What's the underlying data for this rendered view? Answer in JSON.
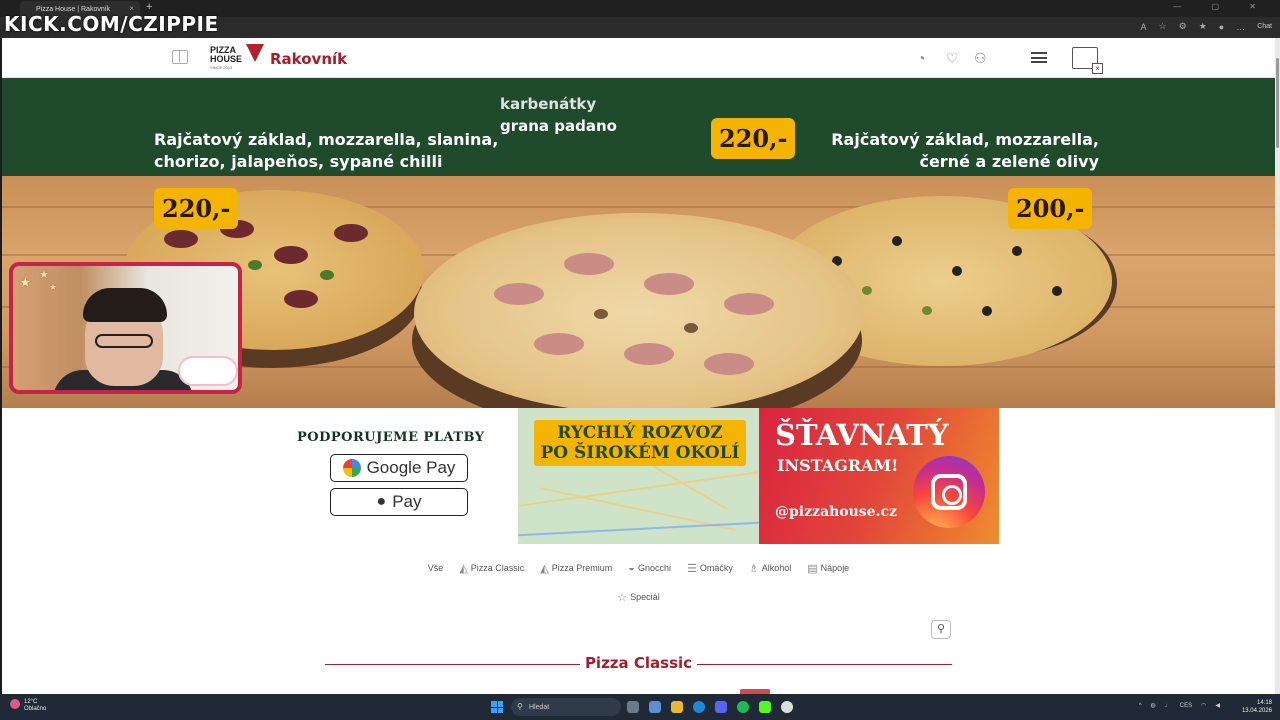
{
  "browser": {
    "tab_title": "Pizza House | Rakovník",
    "tab_close": "×",
    "new_tab": "+",
    "chat_label": "Chat",
    "window_controls": "— ▢ ✕"
  },
  "stream_overlay": {
    "channel": "KICK.COM/CZIPPIE"
  },
  "site": {
    "logo_line1": "PIZZA",
    "logo_line2": "HOUSE",
    "logo_since": "SINCE 2013",
    "city": "Rakovník"
  },
  "hero": {
    "left_desc_line1": "Rajčatový základ, mozzarella, slanina,",
    "left_desc_line2": "chorizo, jalapeňos, sypané chilli",
    "left_price": "220,-",
    "middle_desc_line1": "karbenátky",
    "middle_desc_line2": "grana padano",
    "middle_price": "220,-",
    "right_desc_line1": "Rajčatový základ, mozzarella,",
    "right_desc_line2": "černé a zelené olivy",
    "right_price": "200,-"
  },
  "payments": {
    "title": "PODPORUJEME PLATBY",
    "google_pay": "Google Pay",
    "apple_pay": "Pay"
  },
  "delivery": {
    "line1": "RYCHLÝ ROZVOZ",
    "line2": "PO ŠIROKÉM OKOLÍ"
  },
  "instagram": {
    "title": "ŠŤAVNATÝ",
    "subtitle": "INSTAGRAM!",
    "handle": "@pizzahouse.cz"
  },
  "categories": [
    {
      "label": "Vše",
      "icon": ""
    },
    {
      "label": "Pizza Classic",
      "icon": "pizza-icon"
    },
    {
      "label": "Pizza Premium",
      "icon": "pizza-icon"
    },
    {
      "label": "Gnocchi",
      "icon": "gnocchi-icon"
    },
    {
      "label": "Omáčky",
      "icon": "sauce-icon"
    },
    {
      "label": "Alkohol",
      "icon": "bottle-icon"
    },
    {
      "label": "Nápoje",
      "icon": "drink-icon"
    }
  ],
  "categories_row2": [
    {
      "label": "Speciál",
      "icon": "star-icon"
    }
  ],
  "section": {
    "title": "Pizza Classic"
  },
  "taskbar": {
    "temperature": "12°C",
    "weather": "Oblačno",
    "search_placeholder": "Hledat",
    "language": "CES",
    "time": "14:18",
    "date": "13.04.2026"
  },
  "colors": {
    "brand_red": "#a31f2b",
    "hero_green": "#1f4a2b",
    "price_yellow": "#f5b400",
    "webcam_border": "#c4244a"
  }
}
